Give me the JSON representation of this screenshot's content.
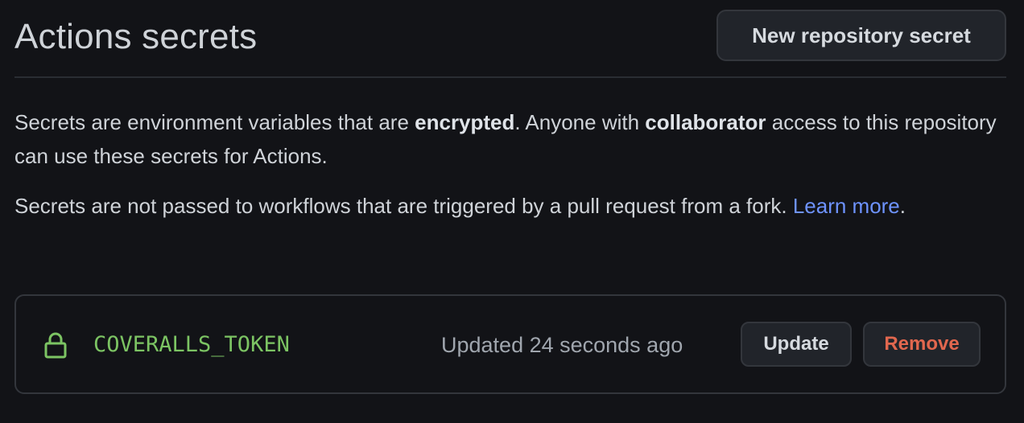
{
  "header": {
    "title": "Actions secrets",
    "new_secret_button": "New repository secret"
  },
  "description": {
    "p1_part1": "Secrets are environment variables that are ",
    "p1_bold1": "encrypted",
    "p1_part2": ". Anyone with ",
    "p1_bold2": "collaborator",
    "p1_part3": " access to this repository can use these secrets for Actions.",
    "p2_text": "Secrets are not passed to workflows that are triggered by a pull request from a fork. ",
    "p2_link": "Learn more",
    "p2_end": "."
  },
  "secrets": [
    {
      "icon": "lock-icon",
      "name": "COVERALLS_TOKEN",
      "updated": "Updated 24 seconds ago",
      "update_label": "Update",
      "remove_label": "Remove"
    }
  ],
  "colors": {
    "background": "#121317",
    "secret_name": "#7cc463",
    "link": "#6e93ff",
    "remove": "#e1674e"
  }
}
